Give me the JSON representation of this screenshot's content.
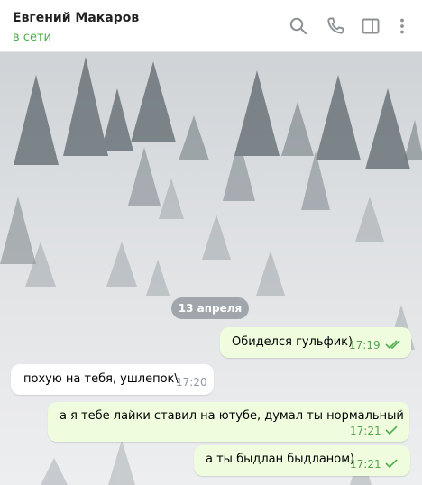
{
  "header": {
    "contact_name": "Евгений Макаров",
    "status": "в сети",
    "icons": [
      "search-icon",
      "phone-icon",
      "sidebar-toggle-icon",
      "more-vert-icon"
    ]
  },
  "chat": {
    "date_separator": "13 апреля",
    "messages": [
      {
        "direction": "out",
        "text": "Обиделся гульфик)",
        "time": "17:19",
        "status": "read"
      },
      {
        "direction": "in",
        "text": "похую на тебя, ушлепок\\",
        "time": "17:20"
      },
      {
        "direction": "out",
        "text": "а я тебе лайки ставил на ютубе, думал ты нормальный",
        "time": "17:21",
        "status": "sent"
      },
      {
        "direction": "out",
        "text": "а ты быдлан быдланом)",
        "time": "17:21",
        "status": "sent"
      }
    ]
  },
  "colors": {
    "status_online": "#4fae4e",
    "outgoing_bubble": "#effdde",
    "incoming_bubble": "#ffffff",
    "check_mark": "#4fae4e",
    "date_pill": "#7a8088"
  }
}
